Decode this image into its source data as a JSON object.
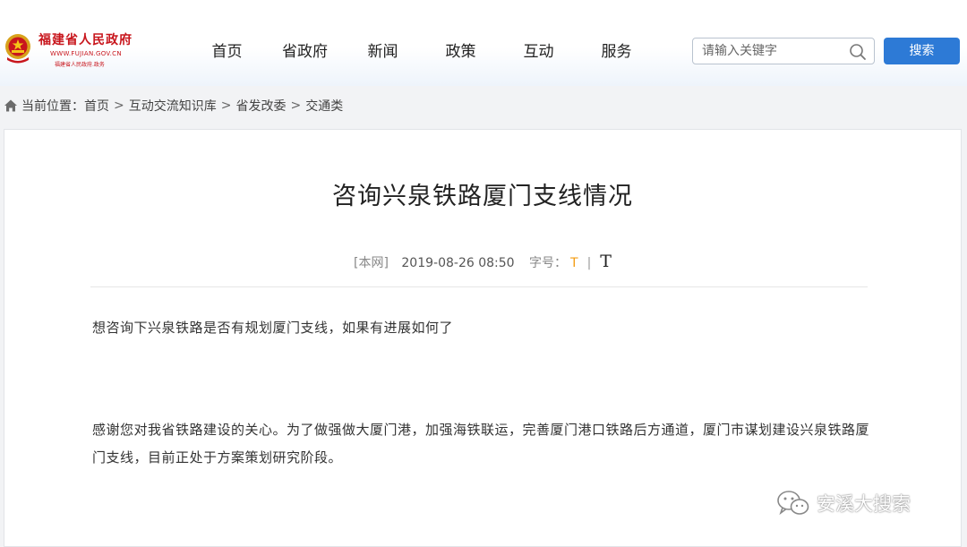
{
  "header": {
    "logo": {
      "name": "福建省人民政府",
      "url_text": "WWW.FUJIAN.GOV.CN",
      "sub_text": "福建省人民政府.政务"
    },
    "nav": [
      "首页",
      "省政府",
      "新闻",
      "政策",
      "互动",
      "服务"
    ],
    "search": {
      "placeholder": "请输入关键字",
      "button": "搜索"
    }
  },
  "breadcrumb": {
    "label": "当前位置：",
    "items": [
      "首页",
      "互动交流知识库",
      "省发改委",
      "交通类"
    ],
    "separator": ">"
  },
  "article": {
    "title": "咨询兴泉铁路厦门支线情况",
    "source": "[本网]",
    "date": "2019-08-26 08:50",
    "font_size_label": "字号：",
    "font_small": "T",
    "font_divider": "|",
    "font_large": "T",
    "question": "想咨询下兴泉铁路是否有规划厦门支线，如果有进展如何了",
    "answer": "感谢您对我省铁路建设的关心。为了做强做大厦门港，加强海铁联运，完善厦门港口铁路后方通道，厦门市谋划建设兴泉铁路厦门支线，目前正处于方案策划研究阶段。"
  },
  "watermark": {
    "text": "安溪大搜索"
  },
  "colors": {
    "brand_red": "#c8161d",
    "accent_blue": "#2d7ad6",
    "font_small_orange": "#f39c12"
  }
}
